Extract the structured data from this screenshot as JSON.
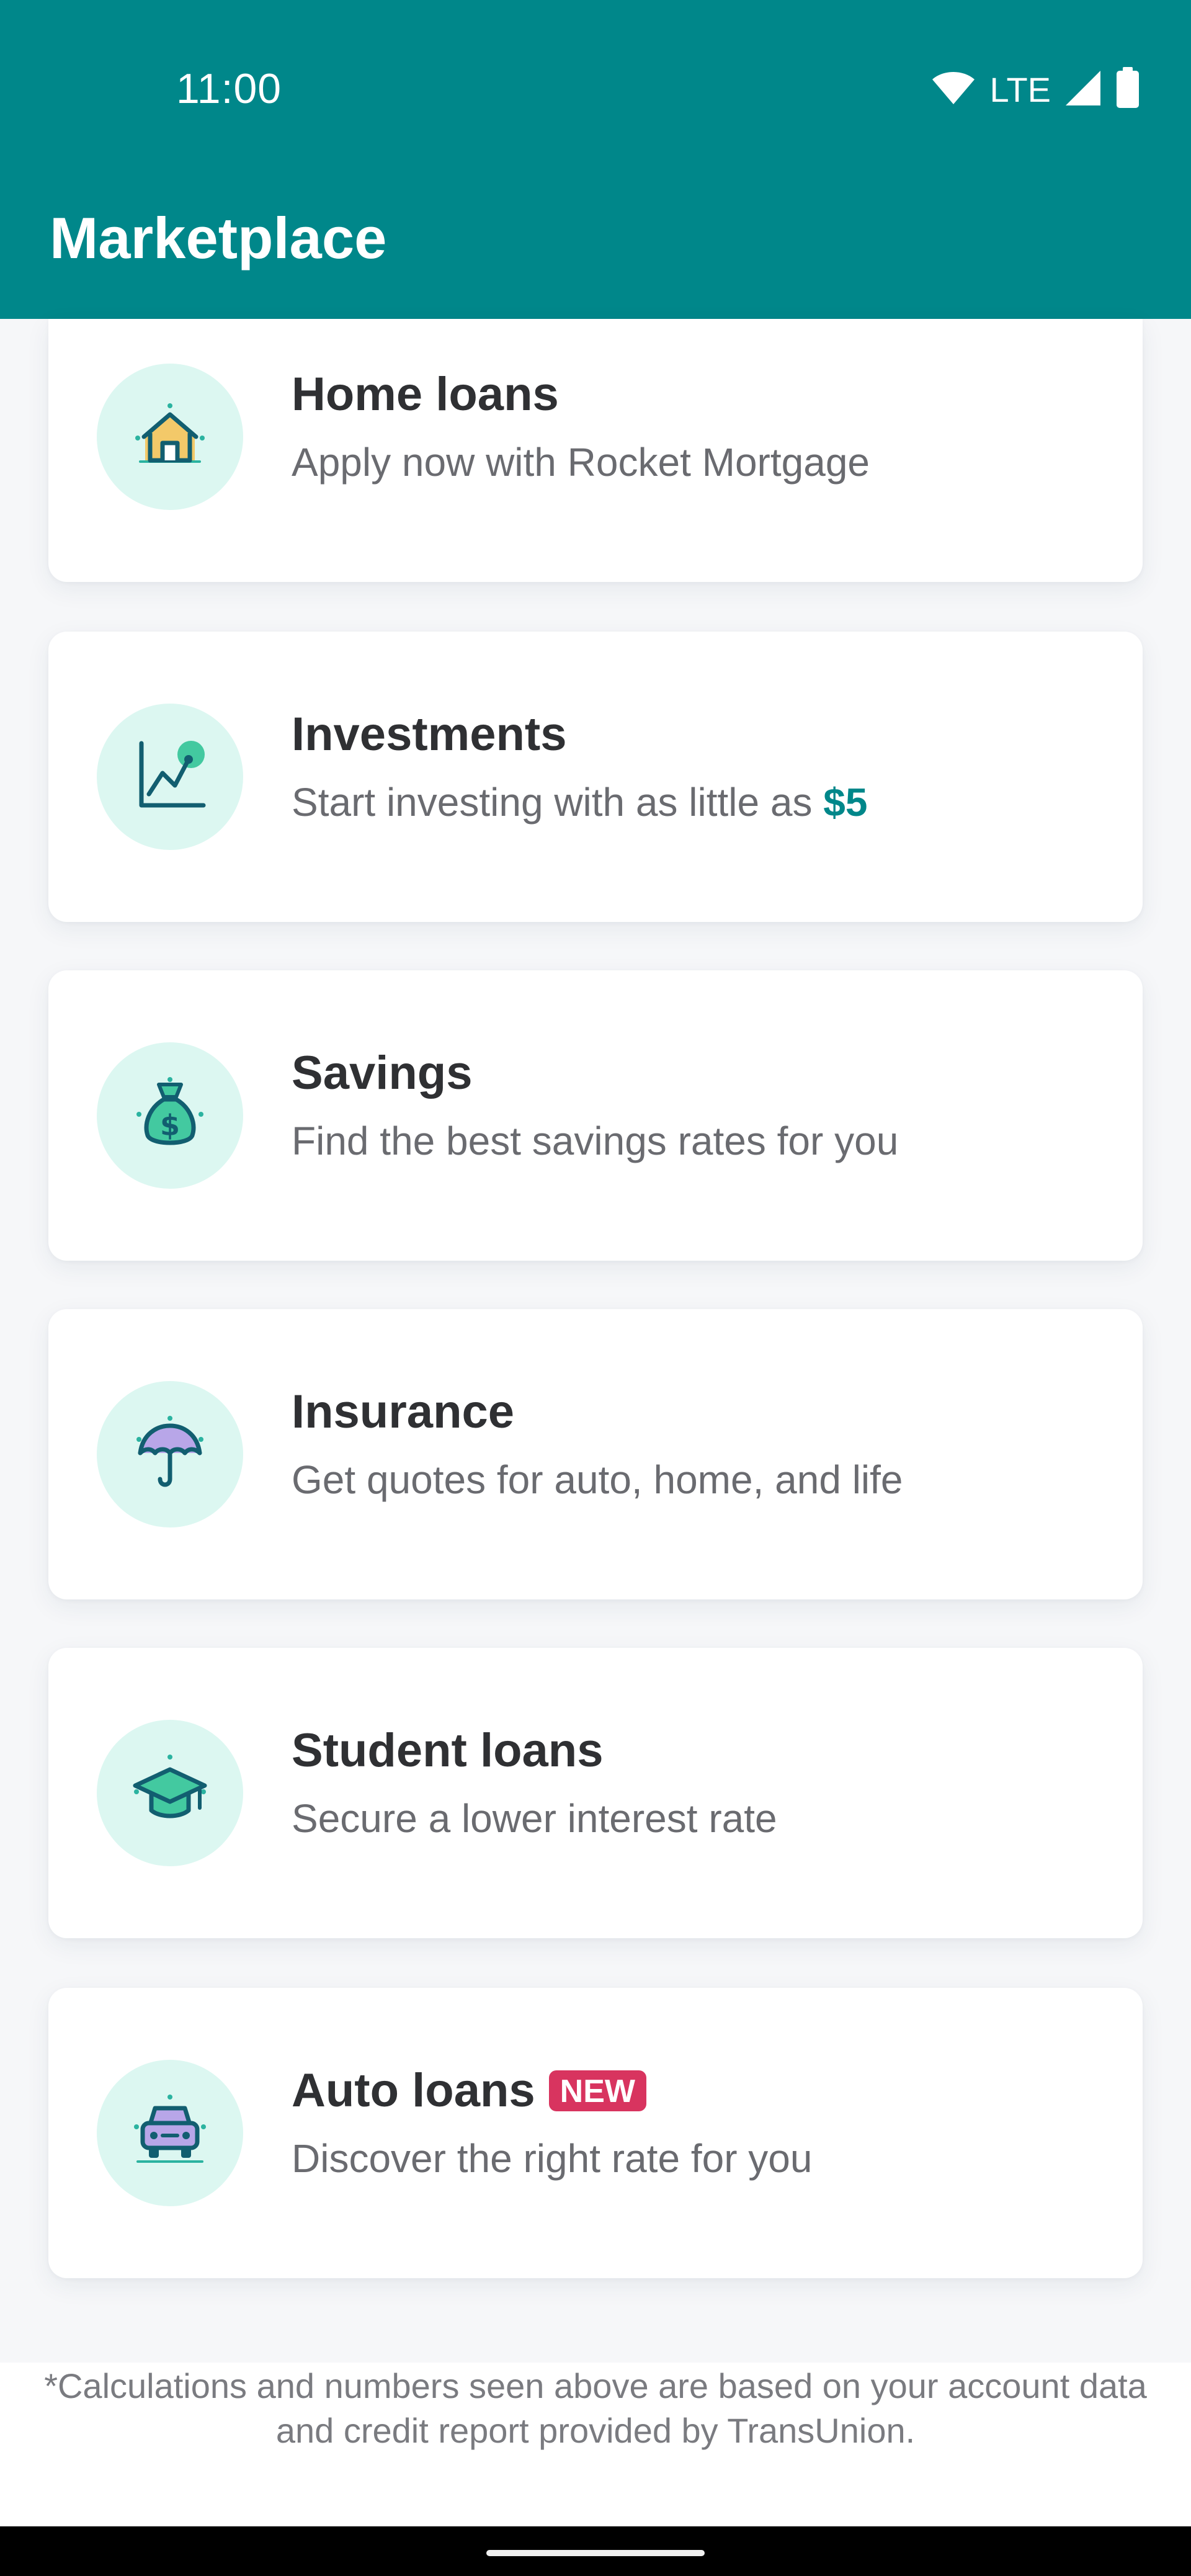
{
  "status_bar": {
    "time": "11:00",
    "network": "LTE",
    "icons": [
      "wifi-icon",
      "cell-signal-icon",
      "battery-icon"
    ]
  },
  "app_bar": {
    "title": "Marketplace"
  },
  "cards": [
    {
      "title": "Home loans",
      "subtitle": "Apply now with Rocket Mortgage",
      "icon": "house-icon"
    },
    {
      "title": "Investments",
      "subtitle_prefix": "Start investing with as little as",
      "subtitle_highlight": "$5",
      "icon": "chart-line-icon"
    },
    {
      "title": "Savings",
      "subtitle": "Find the best savings rates for you",
      "icon": "money-bag-icon"
    },
    {
      "title": "Insurance",
      "subtitle": "Get quotes for auto, home, and life",
      "icon": "umbrella-icon"
    },
    {
      "title": "Student loans",
      "subtitle": "Secure a lower interest rate",
      "icon": "graduation-cap-icon"
    },
    {
      "title": "Auto loans",
      "badge": "NEW",
      "subtitle": "Discover the right rate for you",
      "icon": "car-icon"
    }
  ],
  "footer": {
    "disclaimer": "*Calculations and numbers seen above are based on your account data and credit report provided by TransUnion."
  },
  "colors": {
    "brand": "#00878a",
    "icon_bg": "#dcf7f1",
    "badge": "#d8345f",
    "title_text": "#2f3033",
    "subtitle_text": "#6a6b70"
  }
}
